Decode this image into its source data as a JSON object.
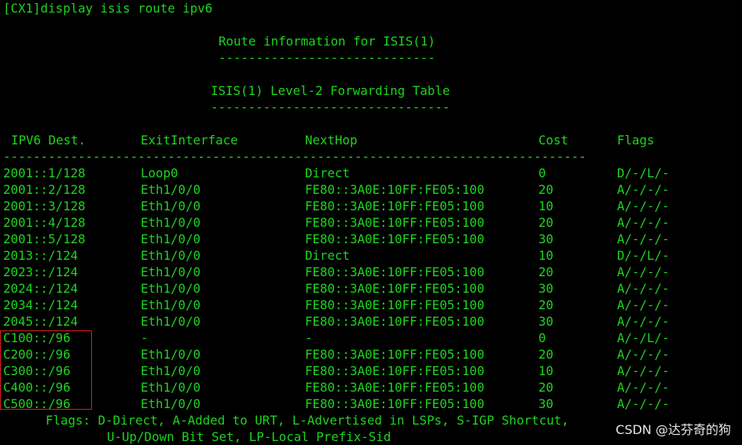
{
  "terminal": {
    "command": "[CX1]display isis route ipv6",
    "route_info_title": "Route information for ISIS(1)",
    "route_info_underline": "-----------------------------",
    "table_title": "ISIS(1) Level-2 Forwarding Table",
    "table_underline": "--------------------------------",
    "headers": {
      "dest": "IPV6 Dest.",
      "exit": "ExitInterface",
      "nexthop": "NextHop",
      "cost": "Cost",
      "flags": "Flags"
    },
    "separator": "------------------------------------------------------------------------------",
    "rows": [
      {
        "dest": "2001::1/128",
        "exit": "Loop0",
        "nexthop": "Direct",
        "cost": "0",
        "flags": "D/-/L/-"
      },
      {
        "dest": "2001::2/128",
        "exit": "Eth1/0/0",
        "nexthop": "FE80::3A0E:10FF:FE05:100",
        "cost": "20",
        "flags": "A/-/-/-"
      },
      {
        "dest": "2001::3/128",
        "exit": "Eth1/0/0",
        "nexthop": "FE80::3A0E:10FF:FE05:100",
        "cost": "10",
        "flags": "A/-/-/-"
      },
      {
        "dest": "2001::4/128",
        "exit": "Eth1/0/0",
        "nexthop": "FE80::3A0E:10FF:FE05:100",
        "cost": "20",
        "flags": "A/-/-/-"
      },
      {
        "dest": "2001::5/128",
        "exit": "Eth1/0/0",
        "nexthop": "FE80::3A0E:10FF:FE05:100",
        "cost": "30",
        "flags": "A/-/-/-"
      },
      {
        "dest": "2013::/124",
        "exit": "Eth1/0/0",
        "nexthop": "Direct",
        "cost": "10",
        "flags": "D/-/L/-"
      },
      {
        "dest": "2023::/124",
        "exit": "Eth1/0/0",
        "nexthop": "FE80::3A0E:10FF:FE05:100",
        "cost": "20",
        "flags": "A/-/-/-"
      },
      {
        "dest": "2024::/124",
        "exit": "Eth1/0/0",
        "nexthop": "FE80::3A0E:10FF:FE05:100",
        "cost": "30",
        "flags": "A/-/-/-"
      },
      {
        "dest": "2034::/124",
        "exit": "Eth1/0/0",
        "nexthop": "FE80::3A0E:10FF:FE05:100",
        "cost": "20",
        "flags": "A/-/-/-"
      },
      {
        "dest": "2045::/124",
        "exit": "Eth1/0/0",
        "nexthop": "FE80::3A0E:10FF:FE05:100",
        "cost": "30",
        "flags": "A/-/-/-"
      },
      {
        "dest": "C100::/96",
        "exit": "-",
        "nexthop": "-",
        "cost": "0",
        "flags": "A/-/L/-"
      },
      {
        "dest": "C200::/96",
        "exit": "Eth1/0/0",
        "nexthop": "FE80::3A0E:10FF:FE05:100",
        "cost": "20",
        "flags": "A/-/-/-"
      },
      {
        "dest": "C300::/96",
        "exit": "Eth1/0/0",
        "nexthop": "FE80::3A0E:10FF:FE05:100",
        "cost": "10",
        "flags": "A/-/-/-"
      },
      {
        "dest": "C400::/96",
        "exit": "Eth1/0/0",
        "nexthop": "FE80::3A0E:10FF:FE05:100",
        "cost": "20",
        "flags": "A/-/-/-"
      },
      {
        "dest": "C500::/96",
        "exit": "Eth1/0/0",
        "nexthop": "FE80::3A0E:10FF:FE05:100",
        "cost": "30",
        "flags": "A/-/-/-"
      }
    ],
    "flags_legend_1": "Flags: D-Direct, A-Added to URT, L-Advertised in LSPs, S-IGP Shortcut,",
    "flags_legend_2": "U-Up/Down Bit Set, LP-Local Prefix-Sid"
  },
  "watermark": "CSDN @达芬奇的狗",
  "colors": {
    "text": "#1ed41e",
    "background": "#000000",
    "highlight": "#d81e1e"
  }
}
